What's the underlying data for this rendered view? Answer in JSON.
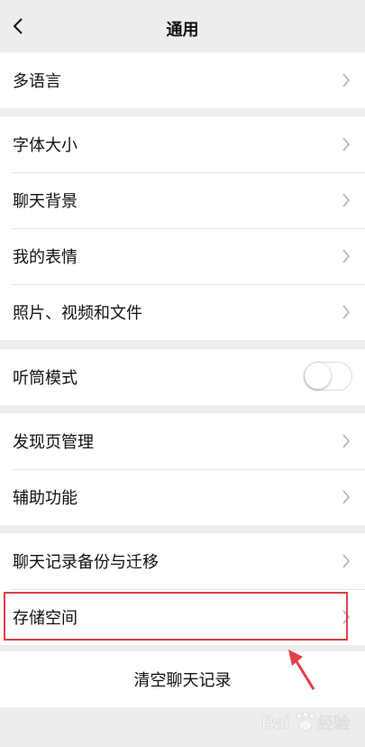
{
  "nav": {
    "title": "通用",
    "back_icon": "chevron-left-icon"
  },
  "groups": [
    {
      "items": [
        {
          "label": "多语言",
          "type": "chevron"
        }
      ]
    },
    {
      "items": [
        {
          "label": "字体大小",
          "type": "chevron"
        },
        {
          "label": "聊天背景",
          "type": "chevron"
        },
        {
          "label": "我的表情",
          "type": "chevron"
        },
        {
          "label": "照片、视频和文件",
          "type": "chevron"
        }
      ]
    },
    {
      "items": [
        {
          "label": "听筒模式",
          "type": "toggle",
          "on": false
        }
      ]
    },
    {
      "items": [
        {
          "label": "发现页管理",
          "type": "chevron"
        },
        {
          "label": "辅助功能",
          "type": "chevron"
        }
      ]
    },
    {
      "items": [
        {
          "label": "聊天记录备份与迁移",
          "type": "chevron"
        },
        {
          "label": "存储空间",
          "type": "chevron",
          "highlighted": true
        }
      ]
    }
  ],
  "clear_button": {
    "label": "清空聊天记录"
  },
  "annotation": {
    "highlight_color": "#e0404a",
    "arrow_color": "#e0404a"
  },
  "watermark": {
    "text": "Bai 经验",
    "paw_icon": "baidu-paw-icon"
  }
}
